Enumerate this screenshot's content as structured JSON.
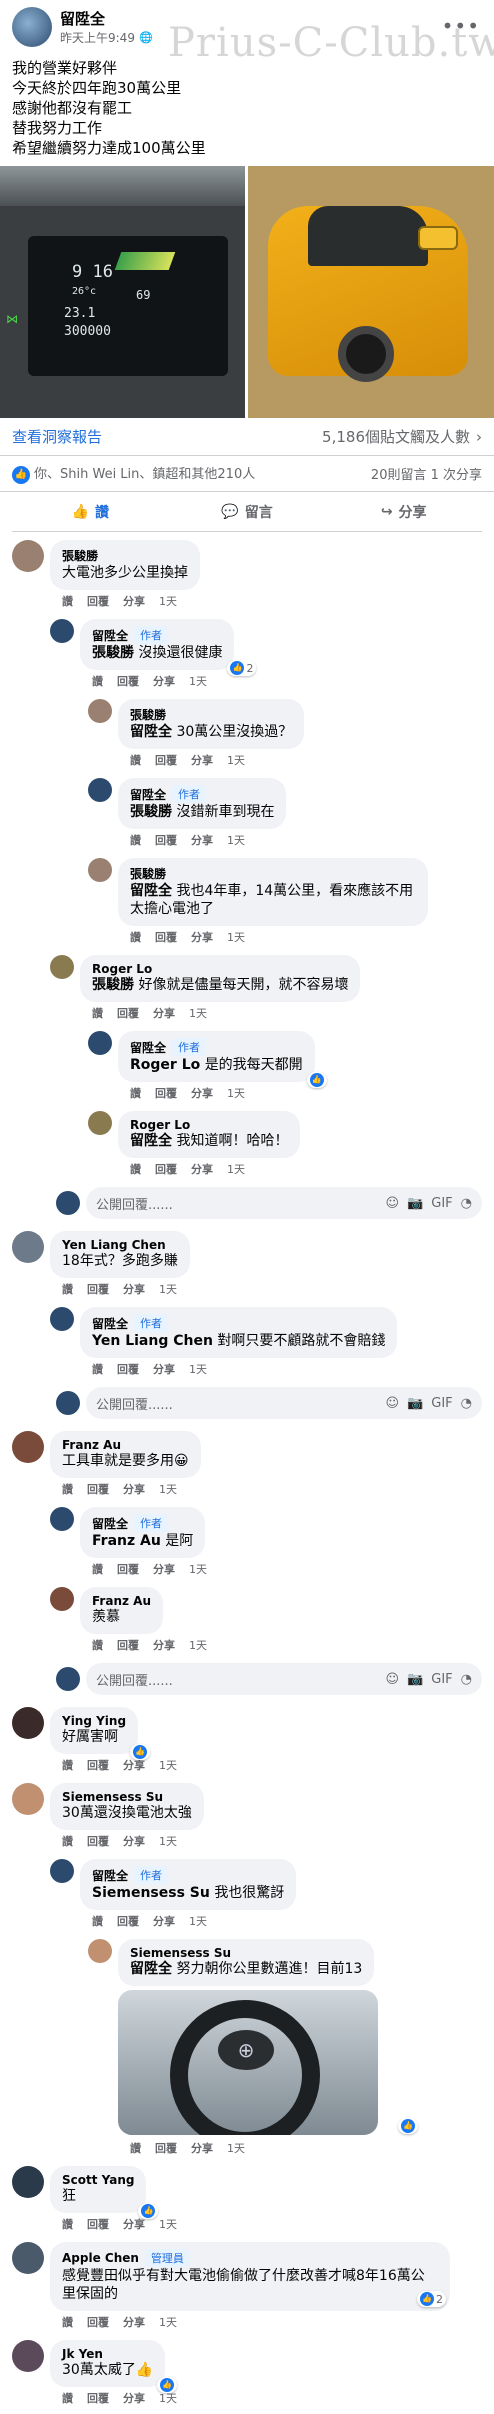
{
  "header": {
    "poster_name": "留陞全",
    "time": "昨天上午9:49",
    "watermark": "Prius-C-Club.tw"
  },
  "post_text": [
    "我的營業好夥伴",
    "今天終於四年跑30萬公里",
    "感謝他都沒有罷工",
    "替我努力工作",
    "希望繼續努力達成100萬公里"
  ],
  "photo_dash": {
    "speed": "9 16",
    "temp": "26°c",
    "eco": "69",
    "distance": "23.1",
    "odo": "300000"
  },
  "insights": {
    "link": "查看洞察報告",
    "reach": "5,186個貼文觸及人數"
  },
  "stats": {
    "reactions": "你、Shih Wei Lin、鎮超和其他210人",
    "counts": "20則留言 1 次分享"
  },
  "actions": {
    "like": "讚",
    "comment": "留言",
    "share": "分享"
  },
  "reply_placeholder": "公開回覆......",
  "comment_actions": {
    "like": "讚",
    "reply": "回覆",
    "share": "分享",
    "time_1d": "1天"
  },
  "author_badge": "作者",
  "admin_badge": "管理員",
  "comments": [
    {
      "name": "張駿勝",
      "text": "大電池多少公里換掉"
    },
    {
      "name": "留陞全",
      "mention": "張駿勝",
      "text": "沒換還很健康",
      "likes": "2"
    },
    {
      "name": "張駿勝",
      "mention": "留陞全",
      "text": "30萬公里沒換過？"
    },
    {
      "name": "留陞全",
      "mention": "張駿勝",
      "text": "沒錯新車到現在"
    },
    {
      "name": "張駿勝",
      "mention": "留陞全",
      "text": "我也4年車，14萬公里，看來應該不用太擔心電池了"
    },
    {
      "name": "Roger Lo",
      "mention": "張駿勝",
      "text": "好像就是儘量每天開，就不容易壞"
    },
    {
      "name": "留陞全",
      "mention": "Roger Lo",
      "text": "是的我每天都開"
    },
    {
      "name": "Roger Lo",
      "mention": "留陞全",
      "text": "我知道啊！哈哈！"
    },
    {
      "name": "Yen Liang Chen",
      "text": "18年式？多跑多賺"
    },
    {
      "name": "留陞全",
      "mention": "Yen Liang Chen",
      "text": "對啊只要不顧路就不會賠錢"
    },
    {
      "name": "Franz Au",
      "text": "工具車就是要多用😀"
    },
    {
      "name": "留陞全",
      "mention": "Franz Au",
      "text": "是阿"
    },
    {
      "name": "Franz Au",
      "text": "羨慕"
    },
    {
      "name": "Ying Ying",
      "text": "好厲害啊"
    },
    {
      "name": "Siemensess Su",
      "text": "30萬還沒換電池太強"
    },
    {
      "name": "留陞全",
      "mention": "Siemensess Su",
      "text": "我也很驚訝"
    },
    {
      "name": "Siemensess Su",
      "mention": "留陞全",
      "text": "努力朝你公里數邁進！目前13"
    },
    {
      "name": "Scott Yang",
      "text": "狂"
    },
    {
      "name": "Apple Chen",
      "text": "感覺豐田似乎有對大電池偷偷做了什麼改善才喊8年16萬公里保固的",
      "likes": "2"
    },
    {
      "name": "Jk Yen",
      "text": "30萬太威了👍"
    }
  ],
  "colors": {
    "accent": "#1877f2",
    "link": "#216fdb",
    "bubble": "#f0f2f5",
    "muted": "#65676b"
  }
}
